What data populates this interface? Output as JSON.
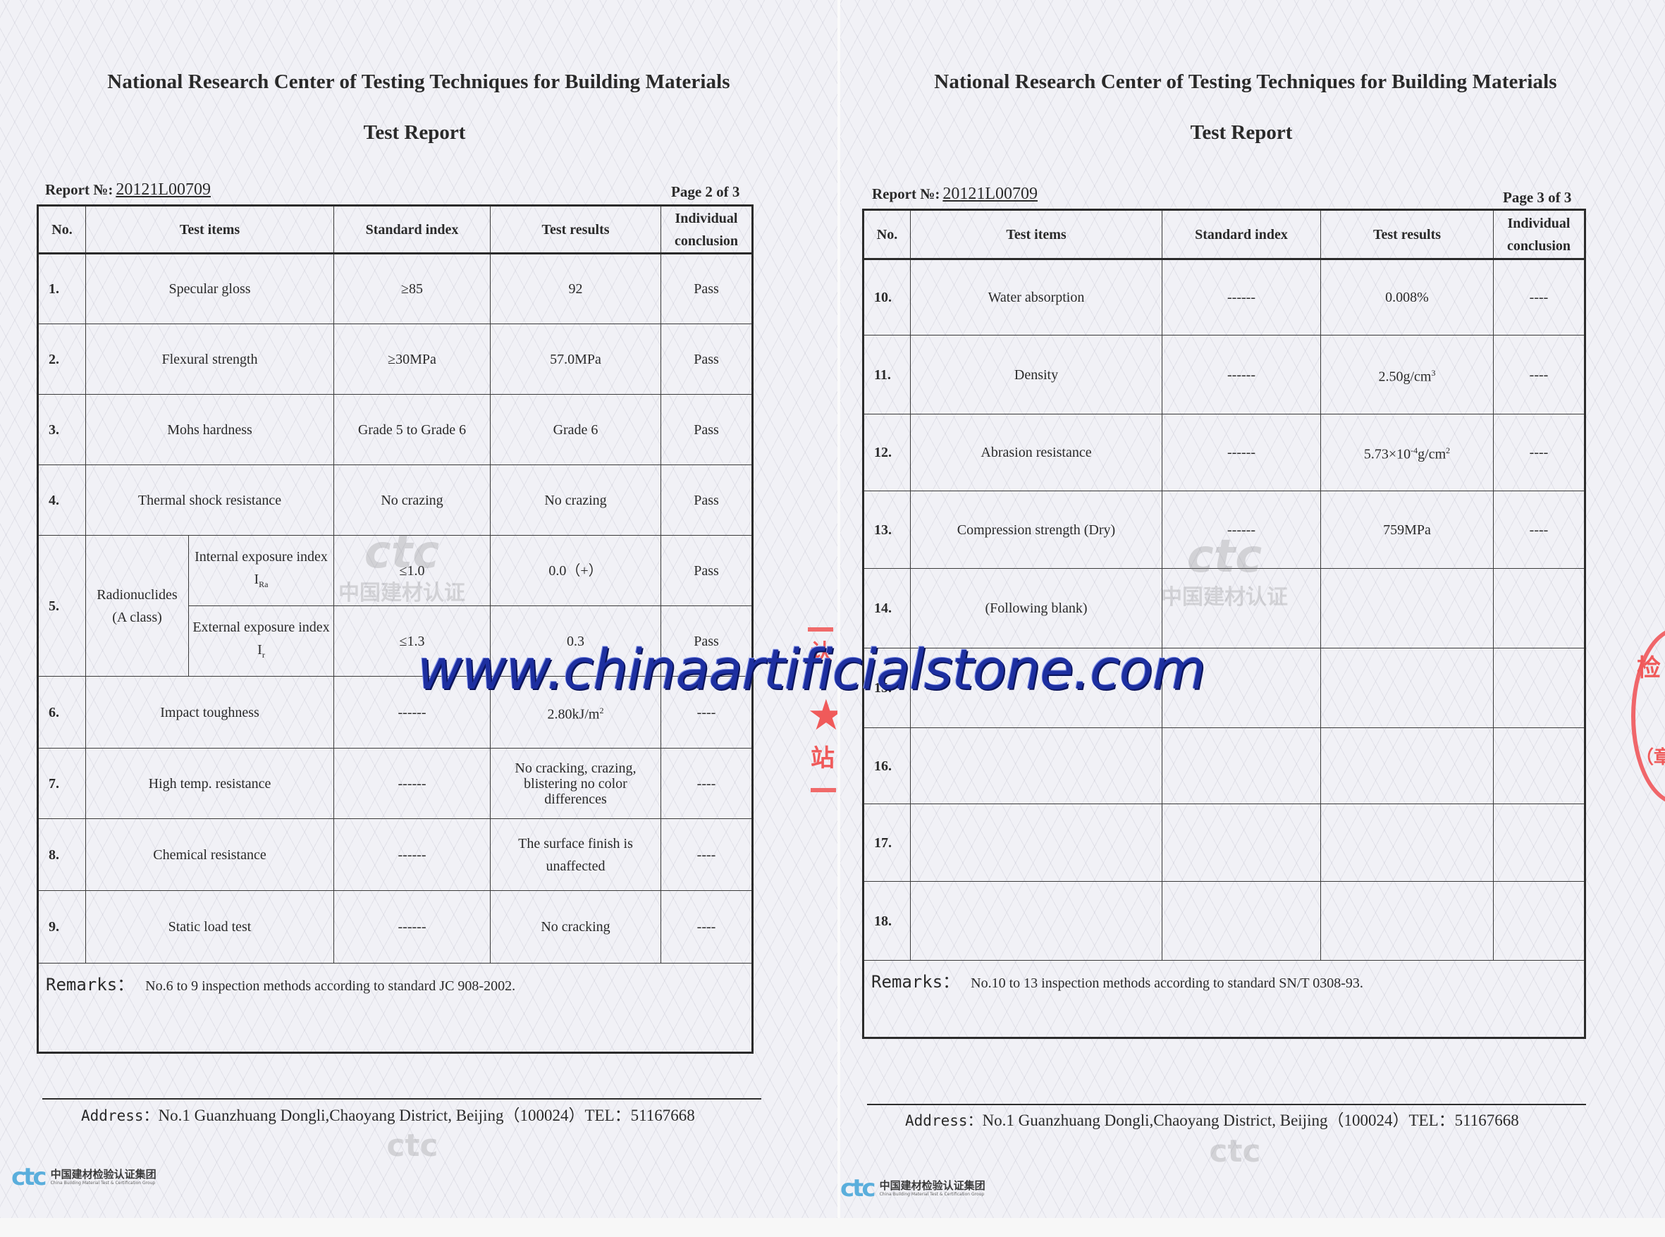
{
  "pages": [
    {
      "org": "National Research Center of Testing Techniques for Building Materials",
      "title": "Test Report",
      "report_no_label": "Report  №:",
      "report_no": "20121L00709",
      "page_label": "Page 2 of 3",
      "headers": [
        "No.",
        "Test items",
        "Standard index",
        "Test results",
        "Individual conclusion"
      ],
      "rows": [
        {
          "no": "1.",
          "item": "Specular gloss",
          "standard": "≥85",
          "result": "92",
          "conclusion": "Pass"
        },
        {
          "no": "2.",
          "item": "Flexural strength",
          "standard": "≥30MPa",
          "result": "57.0MPa",
          "conclusion": "Pass"
        },
        {
          "no": "3.",
          "item": "Mohs hardness",
          "standard": "Grade 5 to Grade 6",
          "result": "Grade 6",
          "conclusion": "Pass"
        },
        {
          "no": "4.",
          "item": "Thermal shock resistance",
          "standard": "No crazing",
          "result": "No crazing",
          "conclusion": "Pass"
        }
      ],
      "row5": {
        "no": "5.",
        "group": "Radionuclides (A class)",
        "sub": [
          {
            "item": "Internal exposure index I",
            "item_sub": "Ra",
            "standard": "≤1.0",
            "result": "0.0（+）",
            "conclusion": "Pass"
          },
          {
            "item": "External exposure index I",
            "item_sub": "r",
            "standard": "≤1.3",
            "result": "0.3",
            "conclusion": "Pass"
          }
        ]
      },
      "rows_b": [
        {
          "no": "6.",
          "item": "Impact toughness",
          "standard": "------",
          "result": "2.80kJ/m",
          "result_sup": "2",
          "conclusion": "----"
        },
        {
          "no": "7.",
          "item": "High temp. resistance",
          "standard": "------",
          "result": "No cracking, crazing, blistering no  color differences",
          "conclusion": "----"
        },
        {
          "no": "8.",
          "item": "Chemical resistance",
          "standard": "------",
          "result": "The surface finish is unaffected",
          "conclusion": "----"
        },
        {
          "no": "9.",
          "item": "Static load test",
          "standard": "------",
          "result": "No cracking",
          "conclusion": "----"
        }
      ],
      "remarks_label": "Remarks：",
      "remarks": "No.6 to 9 inspection methods according to standard JC 908-2002.",
      "address_label": "Address：",
      "address": "No.1 Guanzhuang Dongli,Chaoyang District, Beijing（100024）TEL：51167668"
    },
    {
      "org": "National Research Center of Testing Techniques for Building Materials",
      "title": "Test Report",
      "report_no_label": "Report  №:",
      "report_no": "20121L00709",
      "page_label": "Page 3 of 3",
      "headers": [
        "No.",
        "Test items",
        "Standard index",
        "Test results",
        "Individual conclusion"
      ],
      "rows": [
        {
          "no": "10.",
          "item": "Water absorption",
          "standard": "------",
          "result": "0.008%",
          "result_sup": "",
          "conclusion": "----"
        },
        {
          "no": "11.",
          "item": "Density",
          "standard": "------",
          "result": "2.50g/cm",
          "result_sup": "3",
          "conclusion": "----"
        },
        {
          "no": "12.",
          "item": "Abrasion resistance",
          "standard": "------",
          "result": "5.73×10",
          "result_sup": "-4",
          "result_tail": "g/cm",
          "result_sup2": "2",
          "conclusion": "----"
        },
        {
          "no": "13.",
          "item": "Compression strength (Dry)",
          "standard": "------",
          "result": "759MPa",
          "result_sup": "",
          "conclusion": "----"
        },
        {
          "no": "14.",
          "item": "(Following blank)",
          "standard": "",
          "result": "",
          "result_sup": "",
          "conclusion": ""
        },
        {
          "no": "15.",
          "item": "",
          "standard": "",
          "result": "",
          "result_sup": "",
          "conclusion": ""
        },
        {
          "no": "16.",
          "item": "",
          "standard": "",
          "result": "",
          "result_sup": "",
          "conclusion": ""
        },
        {
          "no": "17.",
          "item": "",
          "standard": "",
          "result": "",
          "result_sup": "",
          "conclusion": ""
        },
        {
          "no": "18.",
          "item": "",
          "standard": "",
          "result": "",
          "result_sup": "",
          "conclusion": ""
        }
      ],
      "remarks_label": "Remarks：",
      "remarks": "No.10 to 13 inspection methods according to standard SN/T 0308-93.",
      "address_label": "Address：",
      "address": "No.1 Guanzhuang Dongli,Chaoyang District, Beijing（100024）TEL：51167668"
    }
  ],
  "logo": {
    "mark": "ctc",
    "cn": "中国建材检验认证集团",
    "en": "China Building Material Test & Certification Group",
    "color": "#5aaedc"
  },
  "faint_seal": {
    "mark": "ctc",
    "cn": "中国建材认证"
  },
  "stamp_fragments": {
    "left_top": "认",
    "left_bottom": "站",
    "right_top": "检",
    "right_bottom": "（章）",
    "color": "#f05a5a"
  },
  "watermark": {
    "text": "www.chinaartificialstone.com",
    "color": "#1d2fa0"
  }
}
